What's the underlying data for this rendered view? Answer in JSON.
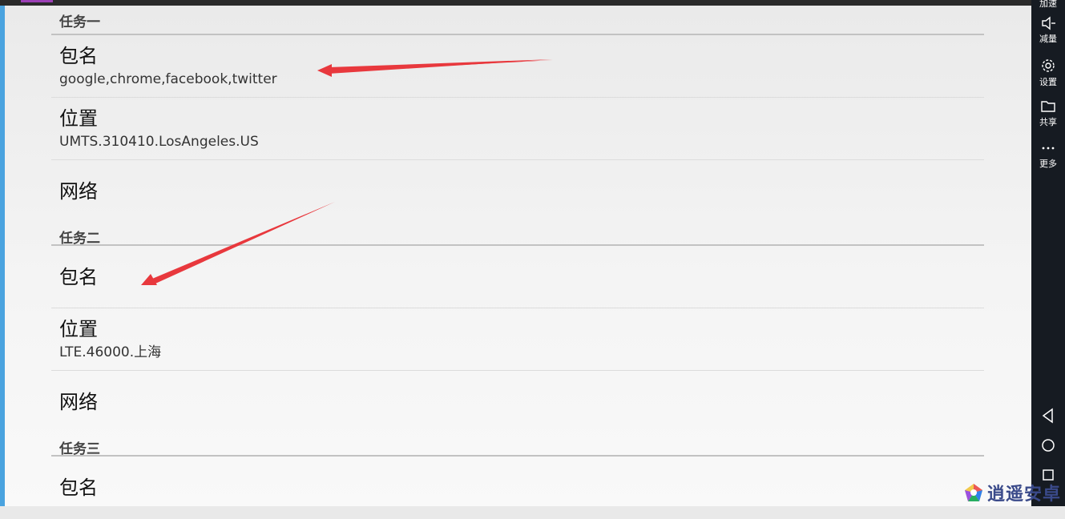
{
  "settings": {
    "tasks": [
      {
        "header": "任务一",
        "rows": [
          {
            "title": "包名",
            "summary": "google,chrome,facebook,twitter"
          },
          {
            "title": "位置",
            "summary": "UMTS.310410.LosAngeles.US"
          },
          {
            "title": "网络",
            "summary": ""
          }
        ]
      },
      {
        "header": "任务二",
        "rows": [
          {
            "title": "包名",
            "summary": ""
          },
          {
            "title": "位置",
            "summary": "LTE.46000.上海"
          },
          {
            "title": "网络",
            "summary": ""
          }
        ]
      },
      {
        "header": "任务三",
        "rows": [
          {
            "title": "包名",
            "summary": ""
          }
        ]
      }
    ]
  },
  "sidebar": {
    "top_partial_label": "加速",
    "items": [
      {
        "label": "减量",
        "icon": "volume-down-icon"
      },
      {
        "label": "设置",
        "icon": "gear-icon"
      },
      {
        "label": "共享",
        "icon": "folder-icon"
      },
      {
        "label": "更多",
        "icon": "more-icon"
      }
    ],
    "nav": [
      "back-icon",
      "home-icon",
      "recents-icon"
    ]
  },
  "watermark": {
    "text": "逍遥安卓"
  },
  "colors": {
    "arrow": "#e8383d",
    "sidebar_bg": "#161b22",
    "accent": "#4aa3df"
  }
}
